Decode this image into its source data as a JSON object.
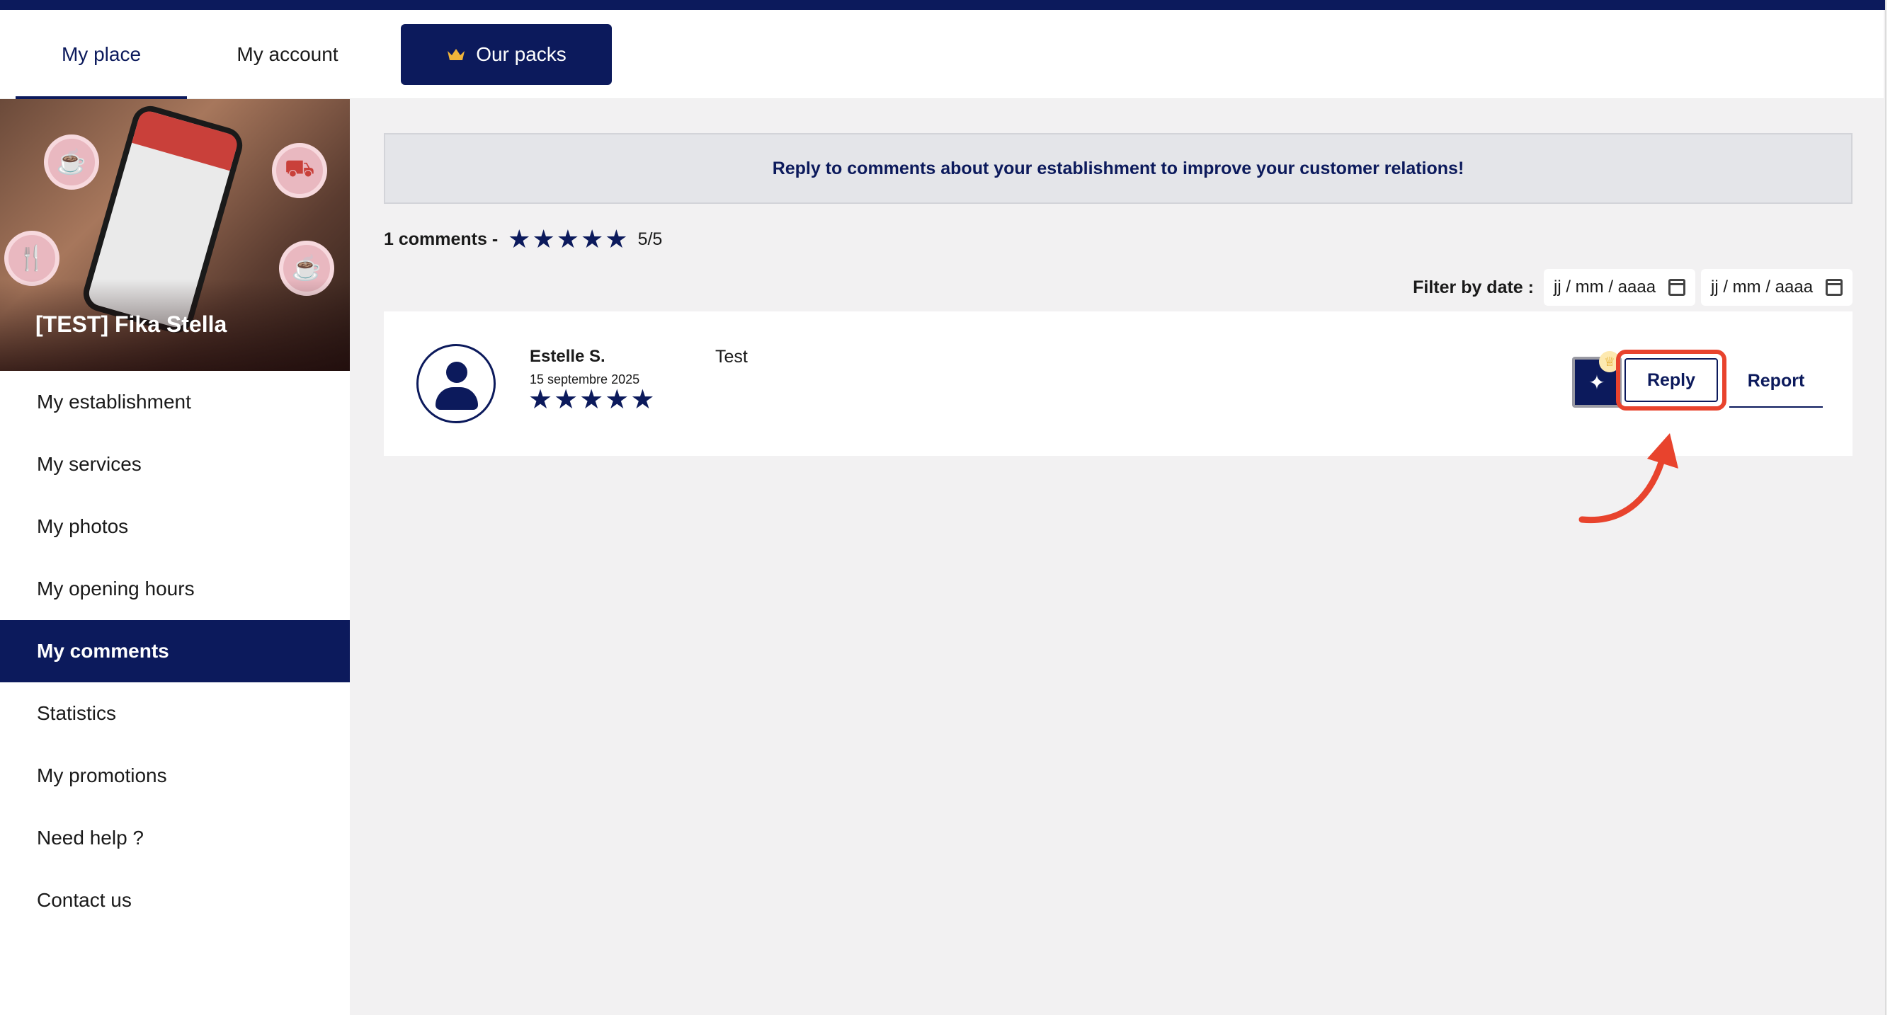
{
  "nav": {
    "tabs": [
      {
        "label": "My place"
      },
      {
        "label": "My account"
      }
    ],
    "packs_label": "Our packs"
  },
  "sidebar": {
    "establishment_name": "[TEST] Fika Stella",
    "items": [
      {
        "label": "My establishment"
      },
      {
        "label": "My services"
      },
      {
        "label": "My photos"
      },
      {
        "label": "My opening hours"
      },
      {
        "label": "My comments"
      },
      {
        "label": "Statistics"
      },
      {
        "label": "My promotions"
      },
      {
        "label": "Need help ?"
      },
      {
        "label": "Contact us"
      }
    ]
  },
  "main": {
    "banner": "Reply to comments about your establishment to improve your customer relations!",
    "summary": {
      "count": "1 comments -",
      "rating": 5,
      "score": "5/5"
    },
    "filter": {
      "label": "Filter by date :",
      "start_placeholder": "jj / mm / aaaa",
      "end_placeholder": "jj / mm / aaaa"
    },
    "comments": [
      {
        "author": "Estelle S.",
        "date": "15 septembre 2025",
        "rating": 5,
        "text": "Test",
        "reply_label": "Reply",
        "report_label": "Report"
      }
    ]
  },
  "colors": {
    "brand": "#0c1a5c",
    "highlight": "#e8432d",
    "crown": "#e0a21c"
  },
  "icons": [
    "crown-icon",
    "calendar-icon",
    "star-icon",
    "user-avatar-icon",
    "pin-icon",
    "arrow-annotation"
  ]
}
